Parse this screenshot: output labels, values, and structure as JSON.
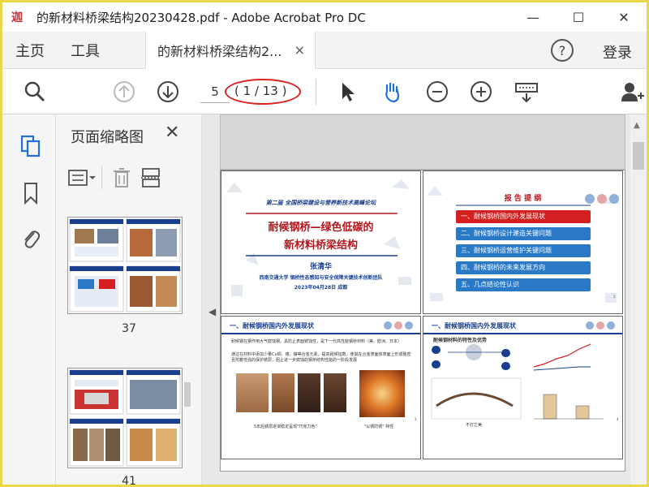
{
  "window": {
    "title": "的新材料桥梁结构20230428.pdf - Adobe Acrobat Pro DC",
    "minimize": "—",
    "maximize": "☐",
    "close": "✕",
    "app_logo": "迦"
  },
  "menubar": {
    "home": "主页",
    "tools": "工具",
    "doc_tab": "的新材料桥梁结构2...",
    "doc_tab_close": "×",
    "help": "?",
    "login": "登录"
  },
  "toolbar": {
    "current_page": "5",
    "page_count": "( 1 / 13 )"
  },
  "panel": {
    "title": "页面缩略图",
    "close": "✕",
    "thumb_labels": [
      "37",
      "41"
    ]
  },
  "slides": {
    "s1": {
      "conference": "第二届 全国桥梁建设与营养新技术高峰论坛",
      "title_line1": "耐候钢桥—绿色低碳的",
      "title_line2": "新材料桥梁结构",
      "author": "张清华",
      "affiliation": "西南交通大学 钢桥性态感知与安全保障关键技术创新团队",
      "date": "2023年04月28日 成都"
    },
    "s2": {
      "heading": "报 告 提 纲",
      "items": [
        "一、耐候钢桥国内外发展现状",
        "二、耐候钢桥设计建造关键问题",
        "三、耐候钢桥运营维护关键问题",
        "四、耐候钢桥的未来发展方向",
        "五、几点结论性认识"
      ]
    },
    "s3": {
      "header": "一、耐候钢桥国内外发展现状",
      "bullets": [
        "耐候钢在钢作用大气腐蚀钢，具防止表面锈蚀性，是下一代高性能钢桥材料（美、欧洲、日本）",
        "通过在材料中添加少量Cu铜、铬、镍等合金元素，提高耐候指数，使其在合金表面体表面上形成致密且附着性强的保护锈层，阻止进一步腐蚀的钢桥结构性能的一阶段发展"
      ],
      "caption1": "5年后锈层逐渐稳定呈现\"巧克力色\"",
      "caption2": "\"以锈防锈\" 特性",
      "page": "3"
    },
    "s4": {
      "header": "一、耐候钢桥国内外发展现状",
      "sub": "耐候钢材料的特性及优势",
      "caption": "不打之美",
      "page": "4"
    }
  }
}
